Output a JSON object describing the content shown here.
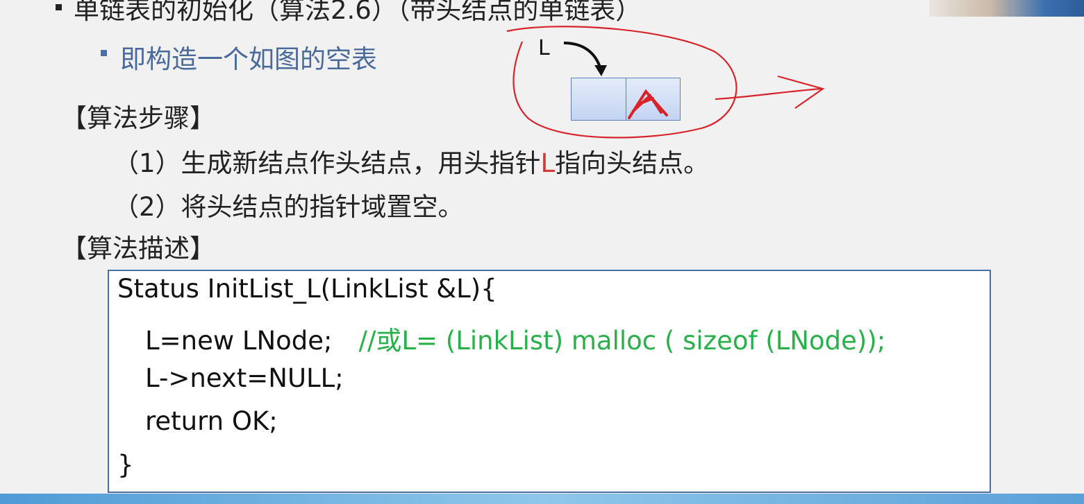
{
  "slide": {
    "title": "单链表的初始化（算法2.6）（带头结点的单链表）",
    "subtitle": "即构造一个如图的空表",
    "steps_heading": "【算法步骤】",
    "step1_a": "（1）生成新结点作头结点，用头指针",
    "step1_L": "L",
    "step1_b": "指向头结点。",
    "step2": "（2）将头结点的指针域置空。",
    "desc_heading": "【算法描述】"
  },
  "diagram": {
    "pointer_label": "L"
  },
  "code": {
    "line1": "Status InitList_L(LinkList &L){",
    "line2_code": "L=new LNode;",
    "line2_comment": "//或L= (LinkList) malloc ( sizeof (LNode));",
    "line3": "L->next=NULL;",
    "line4": "return OK;",
    "line5": "}"
  },
  "colors": {
    "background": "#f1f1f1",
    "subtitle": "#4a6a9a",
    "comment": "#2ab04a",
    "annotation_red": "#d8232a",
    "code_border": "#4a6f9e"
  }
}
